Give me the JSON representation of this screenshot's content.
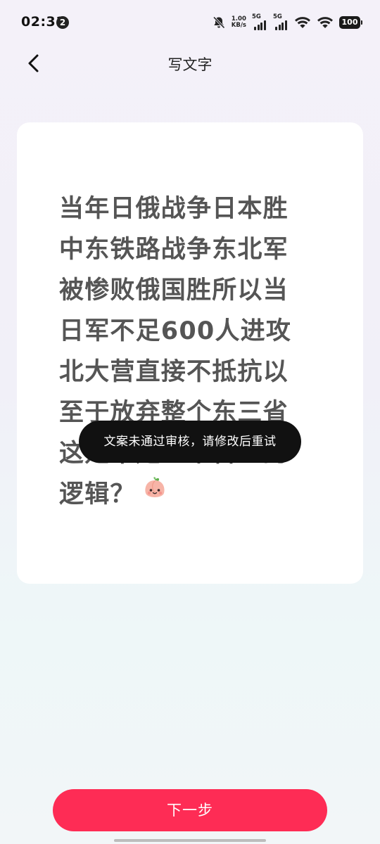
{
  "status_bar": {
    "time": "02:31",
    "notification_count": "2",
    "net_speed_value": "1.00",
    "net_speed_unit": "KB/s",
    "sim1_label": "5G",
    "sim2_label": "5G",
    "battery_level": "100",
    "icons": [
      "mute-bell-icon",
      "signal-icon",
      "wifi-icon",
      "battery-icon"
    ]
  },
  "nav": {
    "back_icon": "chevron-left-icon",
    "title": "写文字"
  },
  "card": {
    "text": "当年日俄战争日本胜中东铁路战争东北军被惨败俄国胜所以当日军不足600人进攻北大营直接不抵抗以至于放弃整个东三省这是不是一个合理的逻辑？",
    "emoji": "peach-face-emoji"
  },
  "toast": {
    "message": "文案未通过审核，请修改后重试"
  },
  "footer": {
    "next_label": "下一步"
  },
  "colors": {
    "accent": "#fe2c55",
    "toast_bg": "#111111",
    "card_text": "#555555"
  }
}
